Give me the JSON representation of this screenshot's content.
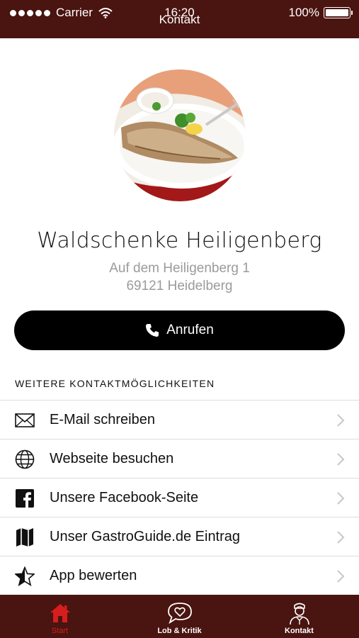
{
  "status_bar": {
    "carrier": "Carrier",
    "time": "16:20",
    "battery": "100%"
  },
  "nav": {
    "title": "Kontakt"
  },
  "restaurant": {
    "name": "Waldschenke Heiligenberg",
    "address_line1": "Auf dem Heiligenberg 1",
    "address_line2": "69121 Heidelberg"
  },
  "call_button": {
    "label": "Anrufen",
    "icon": "phone-icon"
  },
  "section": {
    "title": "WEITERE KONTAKTMÖGLICHKEITEN"
  },
  "contact_options": [
    {
      "label": "E-Mail schreiben",
      "icon": "mail-icon"
    },
    {
      "label": "Webseite besuchen",
      "icon": "globe-icon"
    },
    {
      "label": "Unsere Facebook-Seite",
      "icon": "facebook-icon"
    },
    {
      "label": "Unser GastroGuide.de Eintrag",
      "icon": "map-icon"
    },
    {
      "label": "App bewerten",
      "icon": "star-icon"
    }
  ],
  "tabbar": {
    "tabs": [
      {
        "label": "Start",
        "icon": "home-icon",
        "active": true
      },
      {
        "label": "Lob & Kritik",
        "icon": "speech-heart-icon",
        "active": false
      },
      {
        "label": "Kontakt",
        "icon": "waiter-icon",
        "active": false
      }
    ]
  },
  "colors": {
    "bar": "#4a1410",
    "active_tab": "#d61e1e",
    "secondary_text": "#9b9b9b"
  }
}
